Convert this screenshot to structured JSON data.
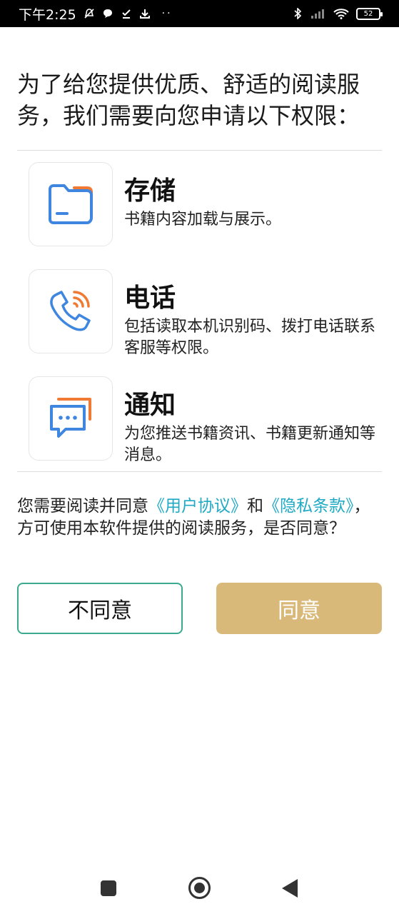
{
  "status_bar": {
    "time": "下午2:25",
    "icons": [
      "mute-icon",
      "chat-icon",
      "check-icon",
      "download-icon",
      "more-dots-icon",
      "bluetooth-icon",
      "signal-icon",
      "wifi-icon",
      "battery-icon"
    ],
    "dots": "··",
    "battery": "52"
  },
  "intro": {
    "text": "为了给您提供优质、舒适的阅读服务，我们需要向您申请以下权限："
  },
  "permissions": [
    {
      "title": "存储",
      "desc": "书籍内容加载与展示。",
      "icon": "folder-icon"
    },
    {
      "title": "电话",
      "desc": "包括读取本机识别码、拨打电话联系客服等权限。",
      "icon": "phone-icon"
    },
    {
      "title": "通知",
      "desc": "为您推送书籍资讯、书籍更新通知等消息。",
      "icon": "message-icon"
    }
  ],
  "agreement": {
    "prefix": "您需要阅读并同意",
    "user_agreement": "《用户协议》",
    "and": "和",
    "privacy_policy": "《隐私条款》",
    "suffix": "，方可使用本软件提供的阅读服务，是否同意？"
  },
  "buttons": {
    "disagree": "不同意",
    "agree": "同意"
  },
  "colors": {
    "link": "#1fa9c4",
    "agree_button": "#d9b979",
    "disagree_border": "#3aa98e",
    "icon_blue": "#3f86e0",
    "icon_orange": "#f07a33"
  },
  "nav_bar": {
    "icons": [
      "recent-apps-icon",
      "home-icon",
      "back-icon"
    ]
  }
}
